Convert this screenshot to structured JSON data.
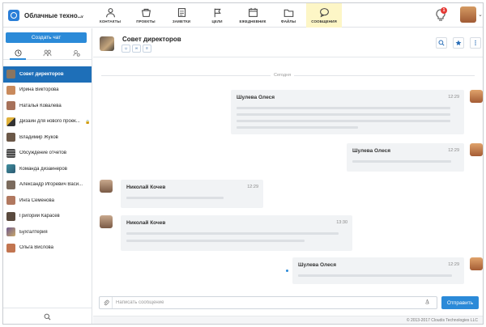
{
  "workspace": {
    "name": "Облачные техно..."
  },
  "nav": {
    "items": [
      {
        "label": "КОНТАКТЫ",
        "icon": "contacts-icon"
      },
      {
        "label": "ПРОЕКТЫ",
        "icon": "projects-icon"
      },
      {
        "label": "ЗАМЕТКИ",
        "icon": "notes-icon"
      },
      {
        "label": "ЦЕЛИ",
        "icon": "goals-icon"
      },
      {
        "label": "ЕЖЕДНЕВНИК",
        "icon": "calendar-icon"
      },
      {
        "label": "ФАЙЛЫ",
        "icon": "folder-icon"
      },
      {
        "label": "СООБЩЕНИЯ",
        "icon": "messages-icon",
        "active": true
      }
    ],
    "notification_count": "1"
  },
  "sidebar": {
    "create_chat_label": "Создать чат",
    "tabs": [
      {
        "icon": "clock-icon",
        "active": true
      },
      {
        "icon": "people-icon",
        "active": false
      },
      {
        "icon": "group-settings-icon",
        "active": false
      }
    ],
    "chats": [
      {
        "name": "Совет директоров",
        "active": true,
        "avatar_color": "#8a7560"
      },
      {
        "name": "Ирина Викторова",
        "avatar_color": "#c98a5c"
      },
      {
        "name": "Наталья Ковалева",
        "avatar_color": "#a7715a"
      },
      {
        "name": "Дизайн для нового проек...",
        "avatar_color": "#e0b13a",
        "locked": true
      },
      {
        "name": "Владимир Жуков",
        "avatar_color": "#6b5848"
      },
      {
        "name": "Обсуждение отчетов",
        "avatar_color": "#4a4a4a"
      },
      {
        "name": "Команда дизайнеров",
        "avatar_color": "#3f8f9f"
      },
      {
        "name": "Александр Игоревич Васи...",
        "avatar_color": "#7b6b5d"
      },
      {
        "name": "Инга Семенова",
        "avatar_color": "#b1785f"
      },
      {
        "name": "Григорий Карасев",
        "avatar_color": "#5a4a3e"
      },
      {
        "name": "Бухгалтерия",
        "avatar_color": "#6f5b8f"
      },
      {
        "name": "Ольга Вислова",
        "avatar_color": "#c27550"
      }
    ]
  },
  "chat": {
    "title": "Совет директоров",
    "day_separator": "Сегодня",
    "messages": [
      {
        "author": "Шулева Олеся",
        "time": "12:29",
        "side": "right"
      },
      {
        "author": "Шулева Олеся",
        "time": "12:29",
        "side": "right"
      },
      {
        "author": "Николай Кочев",
        "time": "12:29",
        "side": "left"
      },
      {
        "author": "Николай Кочев",
        "time": "13:30",
        "side": "left"
      },
      {
        "author": "Шулева Олеся",
        "time": "12:29",
        "side": "right"
      }
    ]
  },
  "composer": {
    "placeholder": "Написать сообщение",
    "send_label": "Отправить"
  },
  "footer": {
    "copyright": "© 2013-2017 Cloudis Technologies LLC"
  },
  "colors": {
    "accent": "#2b8ad8",
    "active_chat": "#1e6fb8",
    "active_nav": "#fdf6c6",
    "badge": "#e53935"
  }
}
